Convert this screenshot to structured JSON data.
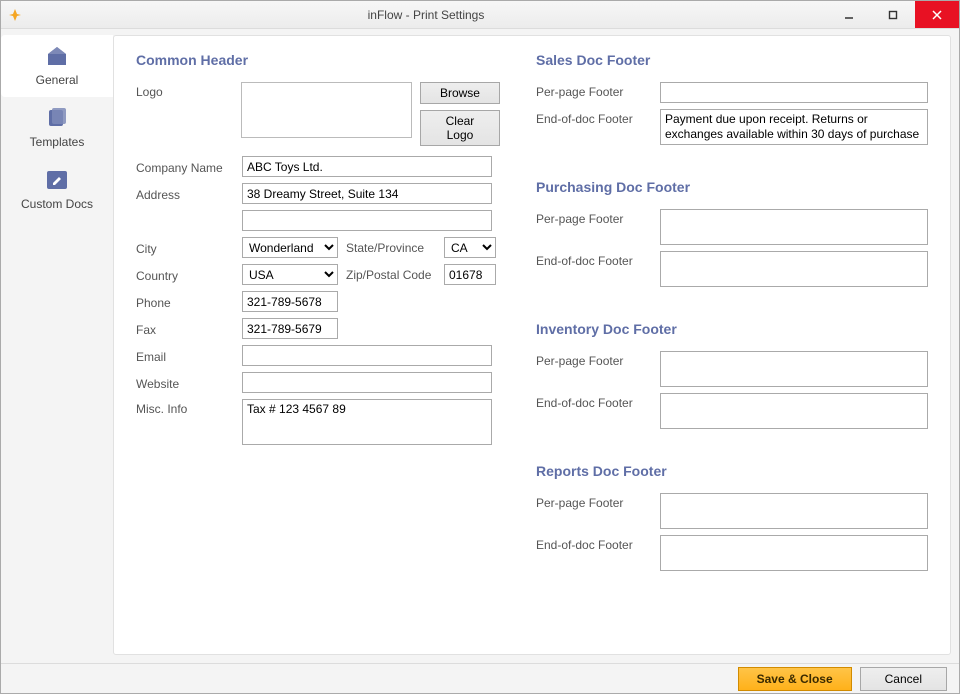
{
  "window": {
    "title": "inFlow - Print Settings"
  },
  "sidebar": {
    "items": [
      {
        "label": "General"
      },
      {
        "label": "Templates"
      },
      {
        "label": "Custom Docs"
      }
    ]
  },
  "commonHeader": {
    "heading": "Common Header",
    "labels": {
      "logo": "Logo",
      "browse": "Browse",
      "clearLogo": "Clear Logo",
      "companyName": "Company Name",
      "address": "Address",
      "city": "City",
      "stateProvince": "State/Province",
      "country": "Country",
      "zipPostal": "Zip/Postal Code",
      "phone": "Phone",
      "fax": "Fax",
      "email": "Email",
      "website": "Website",
      "miscInfo": "Misc. Info"
    },
    "values": {
      "companyName": "ABC Toys Ltd.",
      "address1": "38 Dreamy Street, Suite 134",
      "address2": "",
      "city": "Wonderland",
      "state": "CA",
      "country": "USA",
      "zip": "01678",
      "phone": "321-789-5678",
      "fax": "321-789-5679",
      "email": "",
      "website": "",
      "miscInfo": "Tax # 123 4567 89"
    }
  },
  "sales": {
    "heading": "Sales Doc Footer",
    "perPageLabel": "Per-page Footer",
    "endLabel": "End-of-doc Footer",
    "perPage": "",
    "end": "Payment due upon receipt. Returns or exchanges available within 30 days of purchase with this receipt. "
  },
  "purchasing": {
    "heading": "Purchasing Doc Footer",
    "perPageLabel": "Per-page Footer",
    "endLabel": "End-of-doc Footer",
    "perPage": "",
    "end": ""
  },
  "inventory": {
    "heading": "Inventory Doc Footer",
    "perPageLabel": "Per-page Footer",
    "endLabel": "End-of-doc Footer",
    "perPage": "",
    "end": ""
  },
  "reports": {
    "heading": "Reports Doc Footer",
    "perPageLabel": "Per-page Footer",
    "endLabel": "End-of-doc Footer",
    "perPage": "",
    "end": ""
  },
  "footer": {
    "save": "Save & Close",
    "cancel": "Cancel"
  }
}
